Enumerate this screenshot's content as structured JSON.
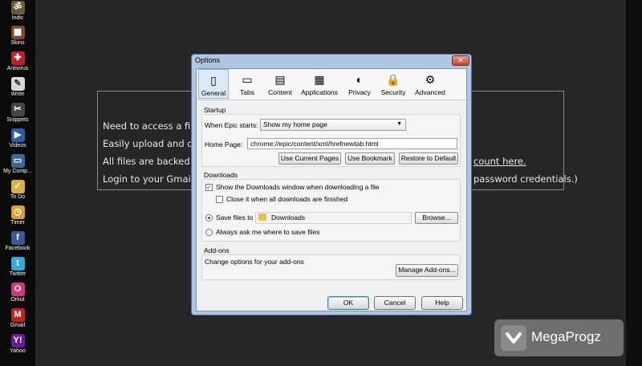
{
  "dock": {
    "items": [
      {
        "label": "Indic",
        "icon": "indic-icon",
        "color": "#6b5a3a",
        "glyph": "ॐ"
      },
      {
        "label": "Skins",
        "icon": "skins-icon",
        "color": "#7a4a2a",
        "glyph": "▦"
      },
      {
        "label": "Antivirus",
        "icon": "antivirus-icon",
        "color": "#c0202a",
        "glyph": "✚"
      },
      {
        "label": "Write",
        "icon": "write-icon",
        "color": "#d8d8d8",
        "glyph": "✎"
      },
      {
        "label": "Snippets",
        "icon": "snippets-icon",
        "color": "#444444",
        "glyph": "✂"
      },
      {
        "label": "Videos",
        "icon": "videos-icon",
        "color": "#2a5db0",
        "glyph": "▶"
      },
      {
        "label": "My Comp...",
        "icon": "my-computer-icon",
        "color": "#3a6a9a",
        "glyph": "▭"
      },
      {
        "label": "To Do",
        "icon": "todo-icon",
        "color": "#d9b23a",
        "glyph": "✓"
      },
      {
        "label": "Timer",
        "icon": "timer-icon",
        "color": "#d9a02a",
        "glyph": "◷"
      },
      {
        "label": "Facebook",
        "icon": "facebook-icon",
        "color": "#3b5998",
        "glyph": "f"
      },
      {
        "label": "Twitter",
        "icon": "twitter-icon",
        "color": "#33aadd",
        "glyph": "t"
      },
      {
        "label": "Orkut",
        "icon": "orkut-icon",
        "color": "#d6337f",
        "glyph": "O"
      },
      {
        "label": "Gmail",
        "icon": "gmail-icon",
        "color": "#c5221f",
        "glyph": "M"
      },
      {
        "label": "Yahoo",
        "icon": "yahoo-icon",
        "color": "#6b1a9a",
        "glyph": "Y!"
      }
    ]
  },
  "background": {
    "lines": [
      "Need to access a file f",
      "Easily upload and dow",
      "All files are backed up",
      "Login to your Gmail Ac"
    ],
    "link_tail": "count here.",
    "tail_text": "password credentials.)"
  },
  "dialog": {
    "title": "Options",
    "close_glyph": "✕",
    "tabs": [
      {
        "label": "General",
        "icon": "general-icon",
        "glyph": "▯"
      },
      {
        "label": "Tabs",
        "icon": "tabs-icon",
        "glyph": "▭"
      },
      {
        "label": "Content",
        "icon": "content-icon",
        "glyph": "▤"
      },
      {
        "label": "Applications",
        "icon": "applications-icon",
        "glyph": "▦"
      },
      {
        "label": "Privacy",
        "icon": "privacy-icon",
        "glyph": "◐"
      },
      {
        "label": "Security",
        "icon": "security-icon",
        "glyph": "🔒"
      },
      {
        "label": "Advanced",
        "icon": "advanced-icon",
        "glyph": "⚙"
      }
    ],
    "startup": {
      "title": "Startup",
      "when_label": "When Epic starts:",
      "when_value": "Show my home page",
      "home_label": "Home Page:",
      "home_value": "chrome://epic/content/xml/hrefnewtab.html",
      "use_current": "Use Current Pages",
      "use_bookmark": "Use Bookmark",
      "restore_default": "Restore to Default"
    },
    "downloads": {
      "title": "Downloads",
      "show_window": "Show the Downloads window when downloading a file",
      "close_when_done": "Close it when all downloads are finished",
      "save_files_to": "Save files to",
      "folder": "Downloads",
      "browse": "Browse...",
      "always_ask": "Always ask me where to save files"
    },
    "addons": {
      "title": "Add-ons",
      "desc": "Change options for your add-ons",
      "manage": "Manage Add-ons..."
    },
    "ok": "OK",
    "cancel": "Cancel",
    "help": "Help"
  },
  "watermark": {
    "text": "MegaProgz"
  }
}
